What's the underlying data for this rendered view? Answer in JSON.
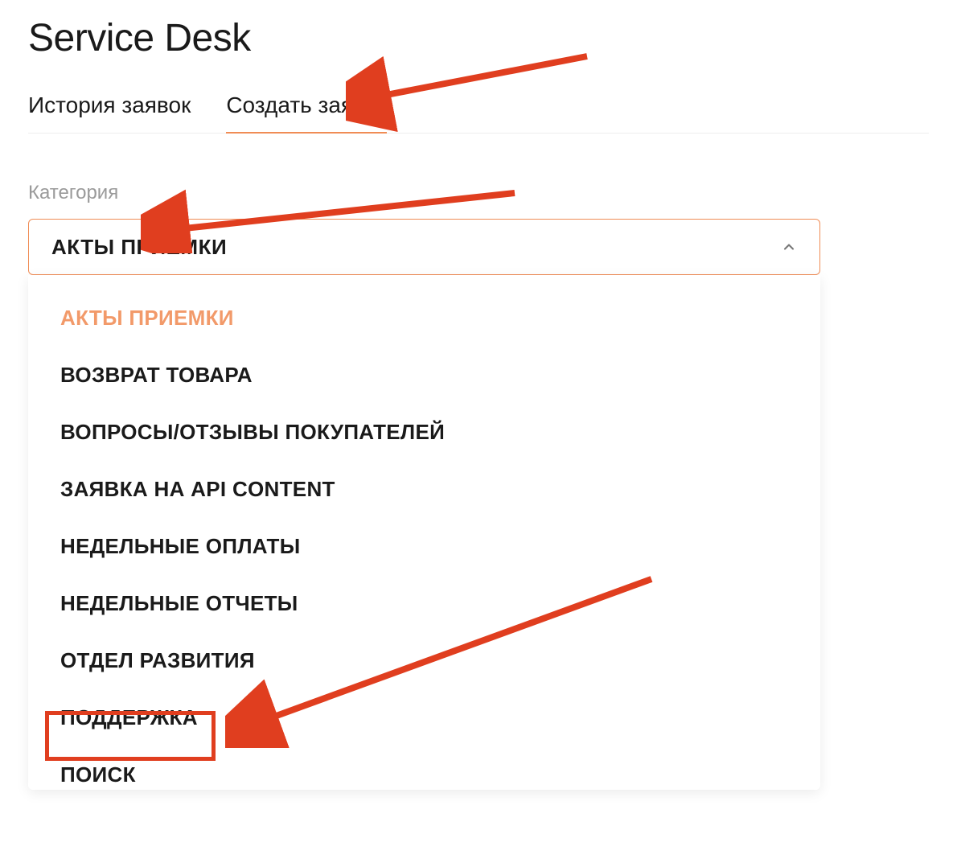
{
  "page_title": "Service Desk",
  "tabs": [
    {
      "label": "История заявок",
      "active": false
    },
    {
      "label": "Создать заявку",
      "active": true
    }
  ],
  "category": {
    "label": "Категория",
    "selected_value": "АКТЫ ПРИЕМКИ",
    "options": [
      {
        "label": "АКТЫ ПРИЕМКИ",
        "selected": true,
        "highlighted": false
      },
      {
        "label": "ВОЗВРАТ ТОВАРА",
        "selected": false,
        "highlighted": false
      },
      {
        "label": "ВОПРОСЫ/ОТЗЫВЫ ПОКУПАТЕЛЕЙ",
        "selected": false,
        "highlighted": false
      },
      {
        "label": "ЗАЯВКА НА API CONTENT",
        "selected": false,
        "highlighted": false
      },
      {
        "label": "НЕДЕЛЬНЫЕ ОПЛАТЫ",
        "selected": false,
        "highlighted": false
      },
      {
        "label": "НЕДЕЛЬНЫЕ ОТЧЕТЫ",
        "selected": false,
        "highlighted": false
      },
      {
        "label": "ОТДЕЛ РАЗВИТИЯ",
        "selected": false,
        "highlighted": false
      },
      {
        "label": "ПОДДЕРЖКА",
        "selected": false,
        "highlighted": true
      },
      {
        "label": "ПОИСК",
        "selected": false,
        "highlighted": false
      }
    ]
  },
  "annotations": {
    "arrows_color": "#e03e1f",
    "highlight_box_color": "#e03e1f"
  }
}
